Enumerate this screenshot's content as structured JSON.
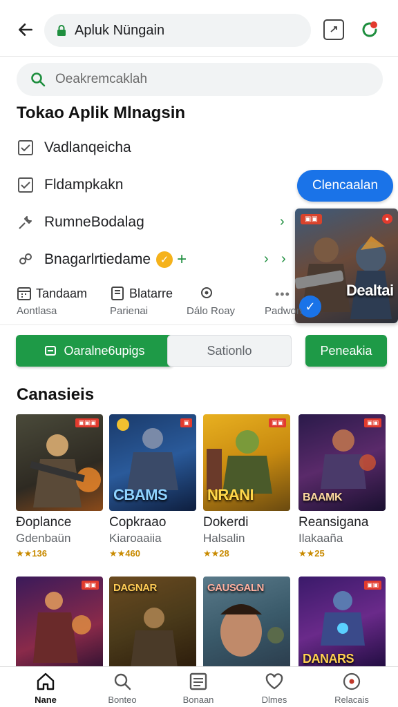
{
  "browser": {
    "url": "Apluk Nüngain"
  },
  "search": {
    "placeholder": "Oeakremcaklah"
  },
  "page_title": "Tokao  Aplik Mlnagsin",
  "menu": [
    {
      "label": "Vadlanqeicha",
      "icon": "checkbox-icon"
    },
    {
      "label": "Fldampkakn",
      "icon": "checkbox-icon"
    },
    {
      "label": "RumneBodalag",
      "icon": "wrench-icon"
    },
    {
      "label": "Bnagarlrtiedame",
      "icon": "gear-icon"
    }
  ],
  "primary_button": "Clencaalan",
  "featured": {
    "title": "Dealtai"
  },
  "shortcuts": [
    {
      "label": "Tandaam",
      "sub": "Aontlasa"
    },
    {
      "label": "Blatarre",
      "sub": "Parienai"
    },
    {
      "label": "",
      "sub": "Dálo Roay"
    },
    {
      "label": "",
      "sub": "Padwon"
    }
  ],
  "actions": {
    "primary": "Oaralne6upigs",
    "secondary": "Sationlo",
    "tertiary": "Peneakia"
  },
  "section_title": "Canasieis",
  "games_row1": [
    {
      "name": "Ðoplance",
      "dev": "Gdenbaün",
      "rating": "★★136",
      "label": ""
    },
    {
      "name": "Copkraao",
      "dev": "Kiaroaaiia",
      "rating": "★★460",
      "label": "CBAMS"
    },
    {
      "name": "Dokerdi",
      "dev": "Halsalin",
      "rating": "★★28",
      "label": "NRANI"
    },
    {
      "name": "Reansigana",
      "dev": "Ilakaaña",
      "rating": "★★25",
      "label": "BAAMK"
    }
  ],
  "games_row2": [
    {
      "label": ""
    },
    {
      "label": "DAGNAR"
    },
    {
      "label": "GAUSGALN"
    },
    {
      "label": "DANARS"
    }
  ],
  "bottom_nav": [
    {
      "label": "Nane"
    },
    {
      "label": "Bonteo"
    },
    {
      "label": "Bonaan"
    },
    {
      "label": "Dlmes"
    },
    {
      "label": "Relacais"
    }
  ],
  "colors": {
    "accent_green": "#1e9a47",
    "accent_blue": "#1a73e8",
    "rating_gold": "#c88a00"
  }
}
